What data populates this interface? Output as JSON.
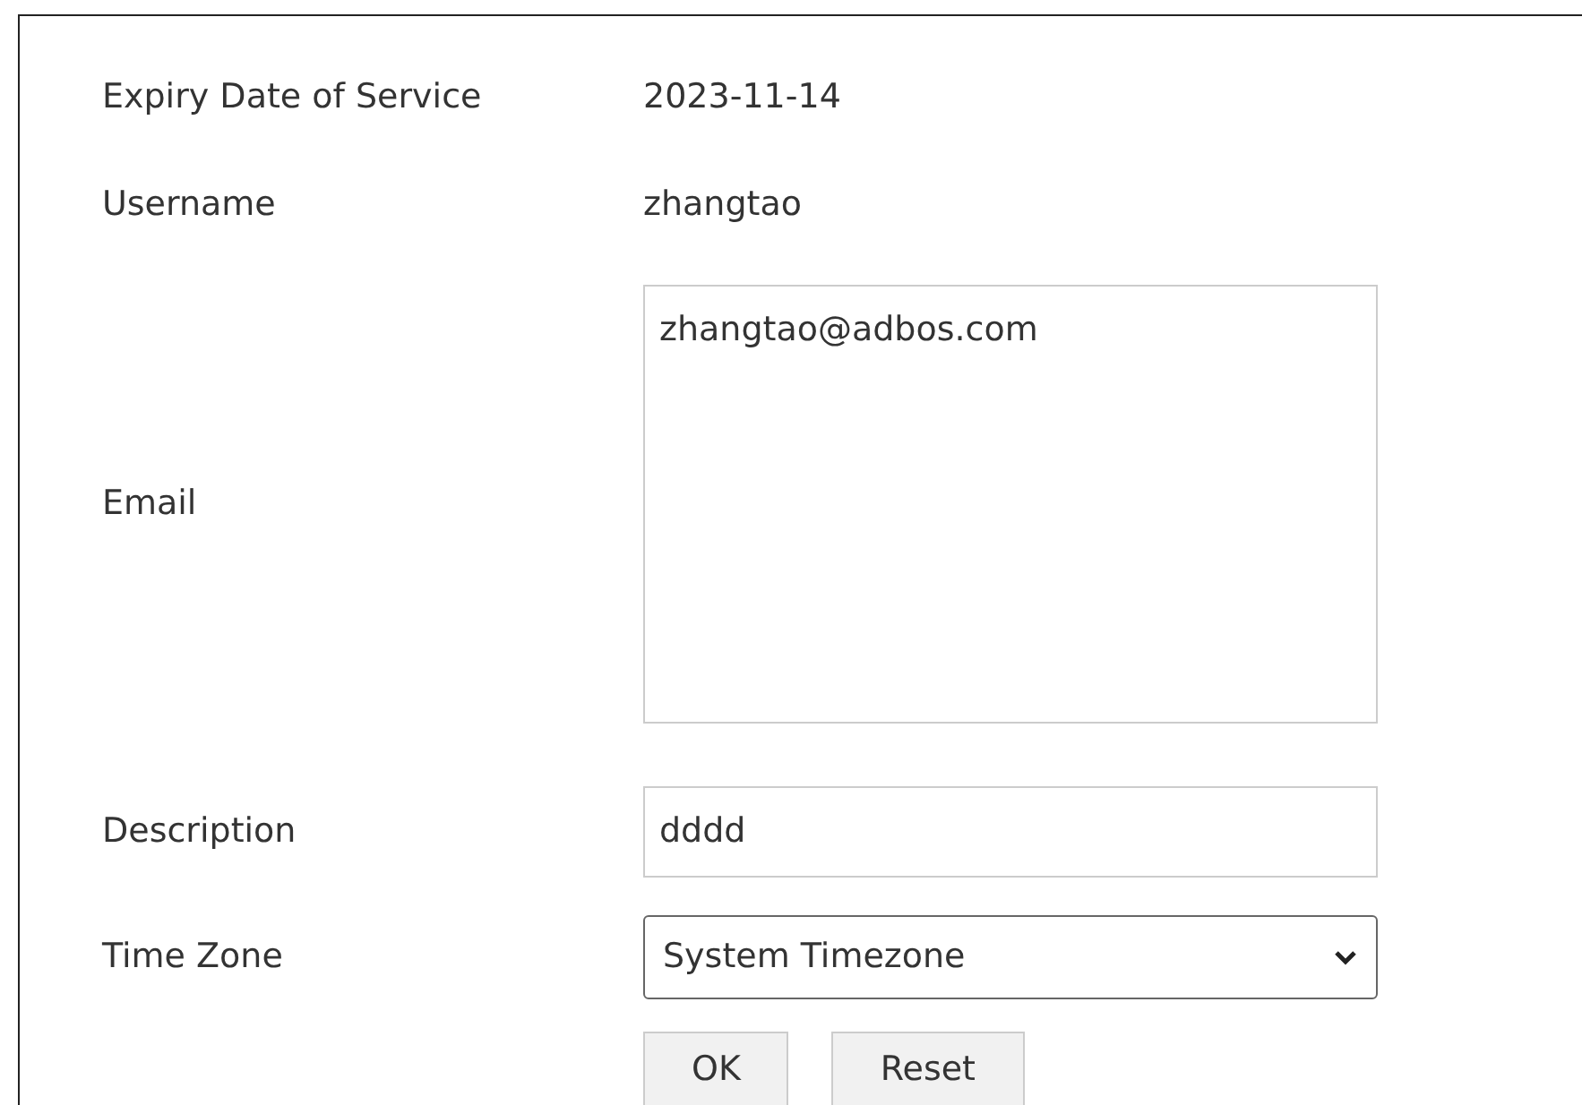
{
  "fields": [
    {
      "kind": "text",
      "label": "Expiry Date of Service",
      "value": "2023-11-14"
    },
    {
      "kind": "text",
      "label": "Username",
      "value": "zhangtao"
    },
    {
      "kind": "textarea",
      "label": "Email",
      "value": "zhangtao@adbos.com"
    },
    {
      "kind": "input",
      "label": "Description",
      "value": "dddd"
    },
    {
      "kind": "select",
      "label": "Time Zone",
      "value": "System Timezone"
    }
  ],
  "buttons": [
    "OK",
    "Reset"
  ]
}
